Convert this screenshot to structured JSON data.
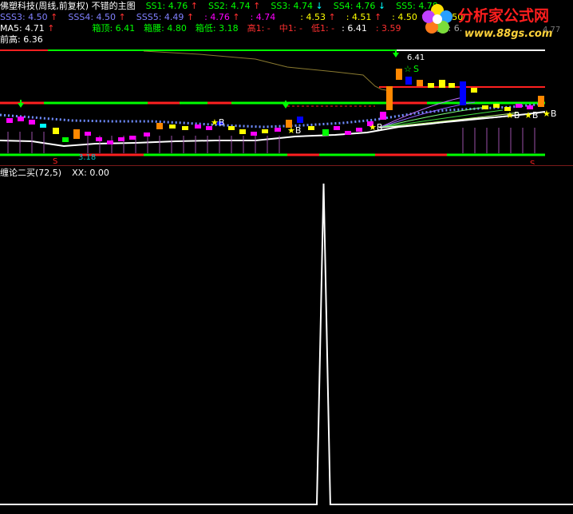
{
  "header": {
    "title": "佛塑科技(周线,前复权) 不错的主图",
    "ss": [
      {
        "label": "SS1:",
        "value": "4.76",
        "arrow": "↑"
      },
      {
        "label": "SS2:",
        "value": "4.74",
        "arrow": "↑"
      },
      {
        "label": "SS3:",
        "value": "4.74",
        "arrow": "↓"
      },
      {
        "label": "SS4:",
        "value": "4.76",
        "arrow": "↓"
      },
      {
        "label": "SS5:",
        "value": "4.78",
        "arrow": ""
      }
    ],
    "sss": [
      {
        "label": "SSS3:",
        "value": "4.50",
        "arrow": "↑"
      },
      {
        "label": "SSS4:",
        "value": "4.50",
        "arrow": "↑"
      },
      {
        "label": "SSS5:",
        "value": "4.49",
        "arrow": "↑"
      },
      {
        "label": ":",
        "value": "4.76",
        "arrow": "↑"
      },
      {
        "label": ":",
        "value": "4.74",
        "arrow": ""
      },
      {
        "label": ":",
        "value": "4.53",
        "arrow": "↑"
      },
      {
        "label": ":",
        "value": "4.51",
        "arrow": "↑"
      },
      {
        "label": ":",
        "value": "4.50",
        "arrow": "↑"
      },
      {
        "label": ":",
        "value": "4.50",
        "arrow": ""
      }
    ],
    "ma5_label": "MA5:",
    "ma5_value": "4.71",
    "ma5_arrow": "↑",
    "box_top_label": "箱顶:",
    "box_top_value": "6.41",
    "box_mid_label": "箱腰:",
    "box_mid_value": "4.80",
    "box_low_label": "箱低:",
    "box_low_value": "3.18",
    "high1": "高1: -",
    "mid1": "中1: -",
    "low1": "低1: -",
    "v1": ": 6.41",
    "v2": ": 3.59",
    "high_pos": "高位: 6.",
    "prev_high_label": "前高:",
    "prev_high_value": "6.36"
  },
  "watermark": {
    "brand": "分析家公式网",
    "url": "www.88gs.com",
    "tail": "4.77"
  },
  "panel2": {
    "label": "缠论二买(72,5)",
    "xx_label": "XX:",
    "xx_value": "0.00"
  },
  "colors": {
    "bg": "#000000",
    "up": "#ff3030",
    "down": "#00ff66",
    "yellow": "#ffff00",
    "magenta": "#ff00ff",
    "cyan": "#00ffff",
    "ss_blue": "#8080ff",
    "green_text": "#00ff00"
  },
  "chart_data": [
    {
      "type": "candlestick",
      "title": "佛塑科技(周线,前复权) 不错的主图",
      "annotations": [
        "6.41",
        "3.18",
        "S",
        "B",
        "S",
        "S"
      ],
      "ylim": [
        3.0,
        6.6
      ],
      "box_top": 6.41,
      "box_mid": 4.8,
      "box_low": 3.18,
      "prev_high": 6.36
    },
    {
      "type": "line",
      "title": "缠论二买(72,5)",
      "series": [
        {
          "name": "XX",
          "values": [
            0,
            0,
            0,
            0,
            0,
            0,
            0,
            0,
            0,
            0,
            0,
            0,
            0,
            0,
            0,
            0,
            0,
            0,
            0,
            0,
            0,
            0,
            0,
            0,
            0,
            0,
            0,
            0,
            0,
            0,
            0,
            0,
            0,
            0,
            0,
            0,
            0,
            0,
            0,
            0,
            0,
            0,
            0,
            0,
            0,
            0,
            0,
            0,
            1,
            0,
            0,
            0,
            0,
            0,
            0,
            0,
            0,
            0,
            0,
            0,
            0,
            0,
            0,
            0,
            0,
            0,
            0,
            0,
            0,
            0,
            0,
            0,
            0,
            0,
            0,
            0,
            0,
            0,
            0,
            0,
            0,
            0,
            0,
            0,
            0,
            0
          ]
        }
      ],
      "ylim": [
        0,
        1
      ]
    }
  ]
}
